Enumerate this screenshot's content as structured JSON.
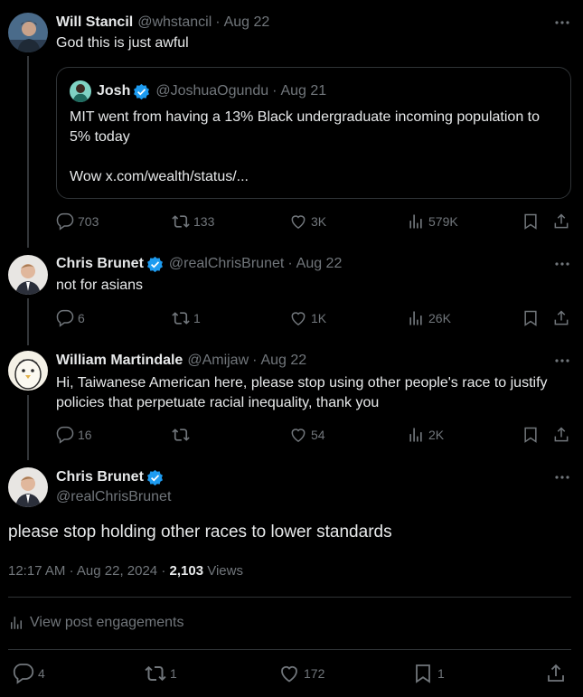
{
  "posts": [
    {
      "name": "Will Stancil",
      "handle": "@whstancil",
      "date": "Aug 22",
      "text": "God this is just awful",
      "verified": false,
      "quote": {
        "name": "Josh",
        "handle": "@JoshuaOgundu",
        "date": "Aug 21",
        "text_line1": "MIT went from having a 13% Black undergraduate incoming population to 5% today",
        "text_line2": "Wow x.com/wealth/status/..."
      },
      "stats": {
        "replies": "703",
        "reposts": "133",
        "likes": "3K",
        "views": "579K"
      }
    },
    {
      "name": "Chris Brunet",
      "handle": "@realChrisBrunet",
      "date": "Aug 22",
      "text": "not for asians",
      "verified": true,
      "stats": {
        "replies": "6",
        "reposts": "1",
        "likes": "1K",
        "views": "26K"
      }
    },
    {
      "name": "William Martindale",
      "handle": "@Amijaw",
      "date": "Aug 22",
      "text": "Hi, Taiwanese American here, please stop using other people's race to justify policies that perpetuate racial inequality, thank you",
      "verified": false,
      "stats": {
        "replies": "16",
        "reposts": "",
        "likes": "54",
        "views": "2K"
      }
    }
  ],
  "main_post": {
    "name": "Chris Brunet",
    "handle": "@realChrisBrunet",
    "text": "please stop holding other races to lower standards",
    "time": "12:17 AM",
    "date": "Aug 22, 2024",
    "views_count": "2,103",
    "views_label": "Views",
    "engagements_label": "View post engagements",
    "stats": {
      "replies": "4",
      "reposts": "1",
      "likes": "172",
      "bookmarks": "1"
    }
  },
  "separator": "·",
  "colors": {
    "background": "#000000",
    "text": "#e7e9ea",
    "muted": "#71767b",
    "verified": "#1d9bf0",
    "border": "#2f3336"
  },
  "icons": [
    "more-icon",
    "verified-badge-icon",
    "reply-icon",
    "repost-icon",
    "like-icon",
    "views-icon",
    "bookmark-icon",
    "share-icon"
  ]
}
